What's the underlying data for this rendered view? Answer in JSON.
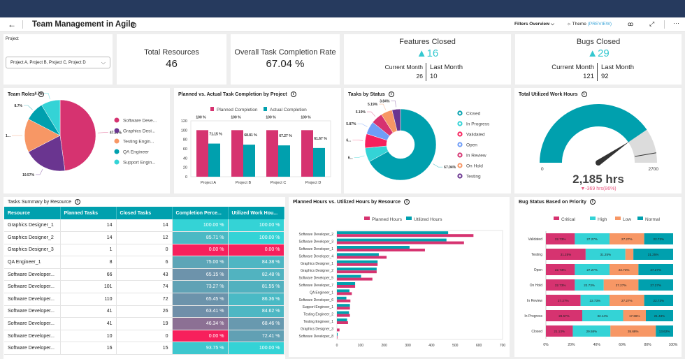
{
  "header": {
    "title": "Team Management in Agile",
    "filters_label": "Filters Overview",
    "theme_label": "Theme",
    "theme_preview": "(PREVIEW)"
  },
  "colors": {
    "pink": "#d63370",
    "purple": "#6a3590",
    "orange": "#f79765",
    "teal": "#00a0ae",
    "cyan": "#34d3d6",
    "red": "#f7205c",
    "blue": "#6f9df7",
    "navy": "#263a5e",
    "grey": "#dcdcdc"
  },
  "project_filter": {
    "label": "Project",
    "value": "Project A, Project B, Project C, Project D"
  },
  "kpis": {
    "total_resources": {
      "title": "Total Resources",
      "value": "46"
    },
    "completion_rate": {
      "title": "Overall Task Completion Rate",
      "value": "67.04 %"
    },
    "features": {
      "title": "Features Closed",
      "value": "16",
      "current_label": "Current Month",
      "last_label": "Last Month",
      "current": "26",
      "last": "10"
    },
    "bugs": {
      "title": "Bugs Closed",
      "value": "29",
      "current_label": "Current Month",
      "last_label": "Last Month",
      "current": "121",
      "last": "92"
    }
  },
  "chart_data": [
    {
      "id": "team_roles",
      "type": "pie",
      "title": "Team Roles",
      "categories": [
        "Software Deve...",
        "Graphics Desi...",
        "Testing Engin...",
        "QA Engineer",
        "Support Engin..."
      ],
      "values": [
        47.83,
        19.57,
        15.22,
        8.7,
        8.7
      ],
      "labels": [
        "47.83%",
        "19.57%",
        "1...",
        "8.7%",
        "8.7%"
      ],
      "colors": [
        "#d63370",
        "#6a3590",
        "#f79765",
        "#00a0ae",
        "#34d3d6"
      ],
      "legend": "right"
    },
    {
      "id": "planned_actual",
      "type": "bar",
      "title": "Planned vs. Actual Task Completion by Project",
      "categories": [
        "Project A",
        "Project B",
        "Project C",
        "Project D"
      ],
      "series": [
        {
          "name": "Planned Completion",
          "values": [
            100,
            100,
            100,
            100
          ],
          "labels": [
            "100 %",
            "100 %",
            "100 %",
            "100 %"
          ],
          "color": "#d63370"
        },
        {
          "name": "Actual Completion",
          "values": [
            71.15,
            68.81,
            67.27,
            61.67
          ],
          "labels": [
            "71.15 %",
            "68.81 %",
            "67.27 %",
            "61.67 %"
          ],
          "color": "#00a0ae"
        }
      ],
      "ylim": [
        0,
        120
      ],
      "yticks": [
        0,
        20,
        40,
        60,
        80,
        100,
        120
      ],
      "legend": "top"
    },
    {
      "id": "tasks_status",
      "type": "pie",
      "donut": true,
      "title": "Tasks by Status",
      "categories": [
        "Closed",
        "In Progress",
        "Validated",
        "Open",
        "In Review",
        "On Hold",
        "Testing"
      ],
      "values": [
        67.04,
        6.4,
        6.47,
        5.87,
        5.19,
        5.19,
        3.84
      ],
      "labels": [
        "67.04%",
        "6...",
        "6...",
        "5.87%",
        "5.19%",
        "5.19%",
        "3.84%"
      ],
      "colors": [
        "#00a0ae",
        "#34d3d6",
        "#f7205c",
        "#6f9df7",
        "#d63370",
        "#f79765",
        "#6a3590"
      ],
      "legend": "right"
    },
    {
      "id": "work_hours",
      "type": "gauge",
      "title": "Total Utilized Work Hours",
      "min": 0,
      "max": 2700,
      "value": 2185,
      "target": 2554,
      "min_label": "0",
      "max_label": "2700",
      "value_label": "2,185 hrs",
      "delta_label": "▼-369 hrs(86%)"
    },
    {
      "id": "hours_by_resource",
      "type": "bar",
      "orientation": "horizontal",
      "title": "Planned Hours vs. Utilized Hours by Resource",
      "categories": [
        "Software Developer_2",
        "Software Developer_3",
        "Software Developer_1",
        "Software Developer_4",
        "Graphics Designer_1",
        "Graphics Designer_2",
        "Software Developer_5",
        "Software Developer_7",
        "QA Engineer_1",
        "Software Developer_6",
        "Support Engineer_1",
        "Testing Engineer_2",
        "Testing Engineer_1",
        "Graphics Designer_3",
        "Software Developer_8"
      ],
      "series": [
        {
          "name": "Planned Hours",
          "values": [
            577,
            537,
            372,
            210,
            172,
            168,
            150,
            77,
            63,
            57,
            55,
            55,
            47,
            11,
            2
          ],
          "color": "#d63370"
        },
        {
          "name": "Utilized Hours",
          "values": [
            470,
            463,
            307,
            177,
            172,
            168,
            102,
            77,
            53,
            40,
            55,
            51,
            43,
            0,
            3
          ],
          "color": "#00a0ae"
        }
      ],
      "xlim": [
        0,
        700
      ],
      "xticks": [
        0,
        100,
        200,
        300,
        400,
        500,
        600,
        700
      ],
      "legend": "top"
    },
    {
      "id": "bug_priority",
      "type": "bar",
      "orientation": "horizontal",
      "stacked": "percent",
      "title": "Bug Status Based on Priority",
      "categories": [
        "Validated",
        "Testing",
        "Open",
        "On Hold",
        "In Review",
        "In Progress",
        "Closed"
      ],
      "series": [
        {
          "name": "Critical",
          "values": [
            22.73,
            31.25,
            22.73,
            22.73,
            27.27,
            28.57,
            21.13
          ],
          "color": "#d63370"
        },
        {
          "name": "High",
          "values": [
            27.27,
            31.25,
            27.27,
            22.73,
            22.73,
            32.14,
            29.58
          ],
          "color": "#34d3d6"
        },
        {
          "name": "Low",
          "values": [
            27.27,
            6.25,
            22.73,
            27.27,
            27.27,
            17.86,
            35.68
          ],
          "color": "#f79765"
        },
        {
          "name": "Normal",
          "values": [
            22.73,
            31.25,
            27.27,
            27.27,
            22.73,
            21.43,
            13.62
          ],
          "color": "#00a0ae"
        }
      ],
      "xticks": [
        "0%",
        "20%",
        "40%",
        "60%",
        "80%",
        "100%"
      ],
      "legend": "top"
    }
  ],
  "table": {
    "title": "Tasks Summary by Resource",
    "columns": [
      "Resource",
      "Planned Tasks",
      "Closed Tasks",
      "Completion Perce...",
      "Utilized Work Hou..."
    ],
    "rows": [
      [
        "Graphics Designer_1",
        "14",
        "14",
        "100.00 %",
        "100.00 %"
      ],
      [
        "Graphics Designer_2",
        "14",
        "12",
        "85.71 %",
        "100.00 %"
      ],
      [
        "Graphics Designer_3",
        "1",
        "0",
        "0.00 %",
        "0.00 %"
      ],
      [
        "QA Engineer_1",
        "8",
        "6",
        "75.00 %",
        "84.38 %"
      ],
      [
        "Software Developer...",
        "66",
        "43",
        "65.15 %",
        "82.48 %"
      ],
      [
        "Software Developer...",
        "101",
        "74",
        "73.27 %",
        "81.55 %"
      ],
      [
        "Software Developer...",
        "110",
        "72",
        "65.45 %",
        "86.36 %"
      ],
      [
        "Software Developer...",
        "41",
        "26",
        "63.41 %",
        "84.62 %"
      ],
      [
        "Software Developer...",
        "41",
        "19",
        "46.34 %",
        "68.46 %"
      ],
      [
        "Software Developer...",
        "10",
        "0",
        "0.00 %",
        "72.41 %"
      ],
      [
        "Software Developer...",
        "16",
        "15",
        "93.75 %",
        "100.00 %"
      ]
    ]
  }
}
